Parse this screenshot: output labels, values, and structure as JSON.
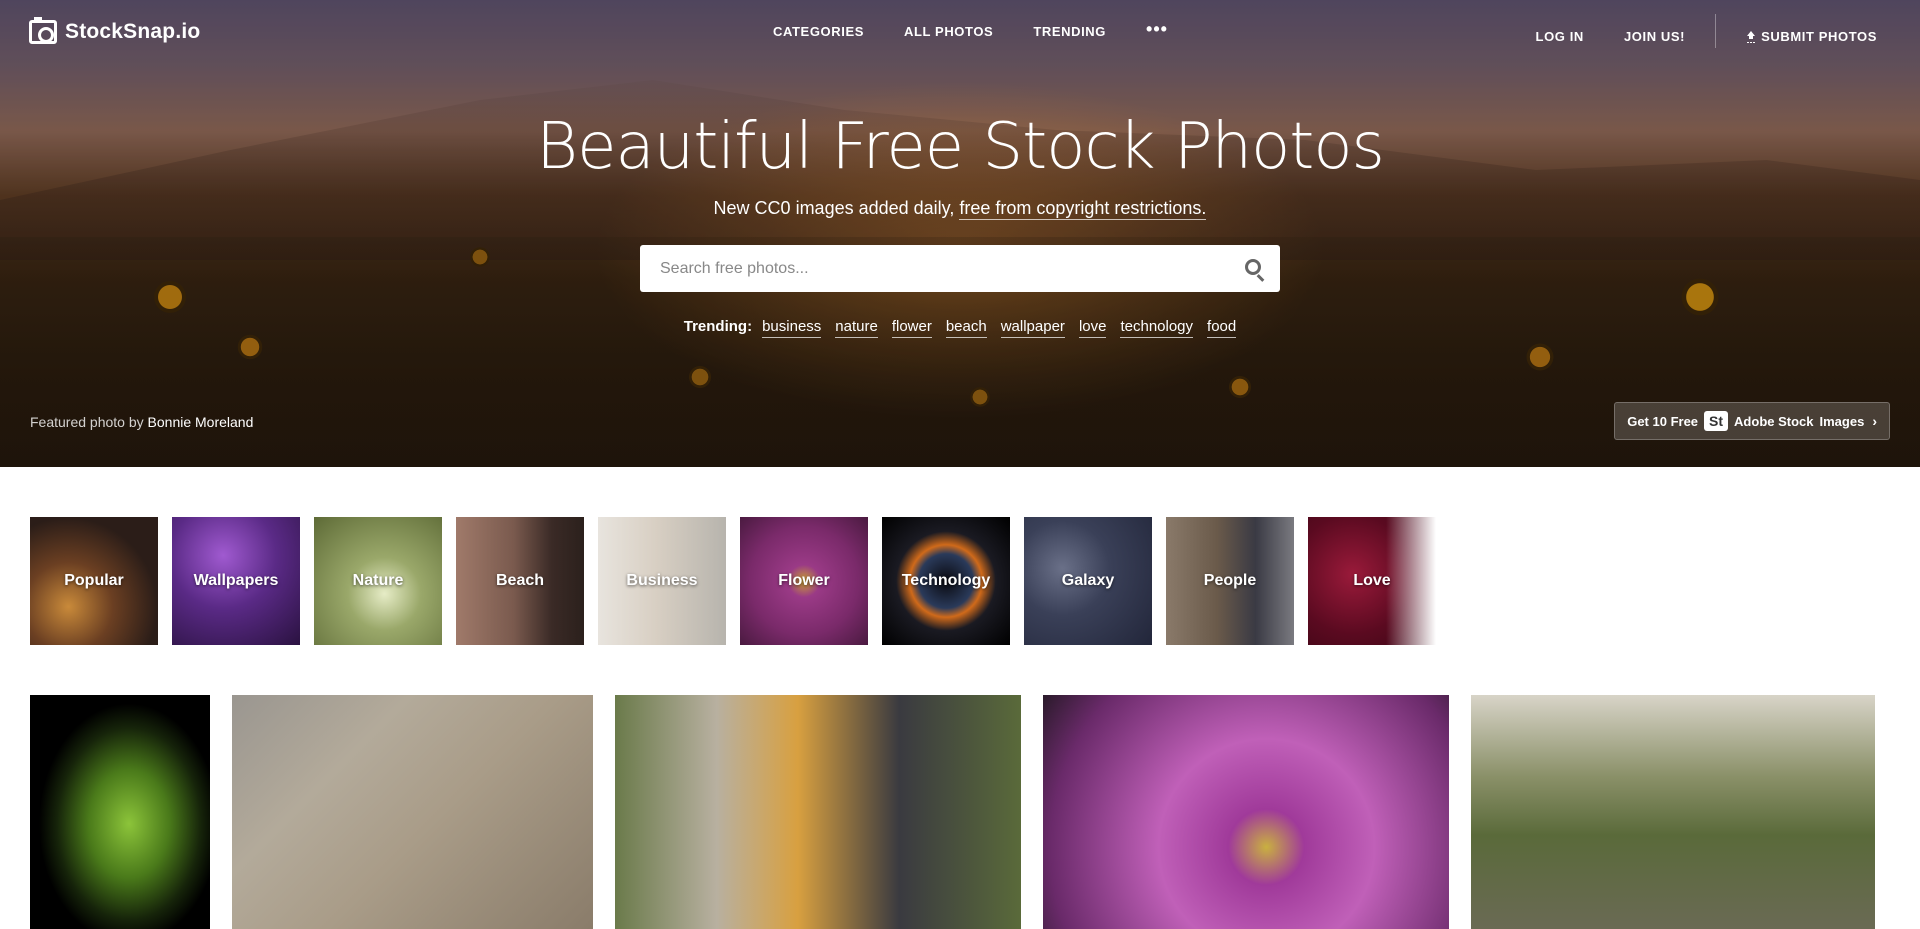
{
  "brand": {
    "name": "StockSnap.io"
  },
  "nav": {
    "links": [
      "CATEGORIES",
      "ALL PHOTOS",
      "TRENDING"
    ],
    "more": "•••",
    "login": "LOG IN",
    "join": "JOIN US!",
    "submit": "SUBMIT PHOTOS"
  },
  "hero": {
    "title": "Beautiful Free Stock Photos",
    "subtitle_prefix": "New CC0 images added daily,",
    "subtitle_link": "free from copyright restrictions.",
    "search_placeholder": "Search free photos...",
    "trending_label": "Trending:",
    "trending_tags": [
      "business",
      "nature",
      "flower",
      "beach",
      "wallpaper",
      "love",
      "technology",
      "food"
    ],
    "featured_prefix": "Featured photo by",
    "featured_author": "Bonnie Moreland",
    "adobe": {
      "get": "Get 10 Free",
      "badge": "St",
      "brand": "Adobe Stock",
      "images": "Images",
      "chevron": "›"
    }
  },
  "categories": [
    {
      "label": "Popular"
    },
    {
      "label": "Wallpapers"
    },
    {
      "label": "Nature"
    },
    {
      "label": "Beach"
    },
    {
      "label": "Business"
    },
    {
      "label": "Flower"
    },
    {
      "label": "Technology"
    },
    {
      "label": "Galaxy"
    },
    {
      "label": "People"
    },
    {
      "label": "Love"
    }
  ],
  "colors": {
    "accent_white": "#ffffff",
    "hero_dark": "#2f1f0f"
  }
}
